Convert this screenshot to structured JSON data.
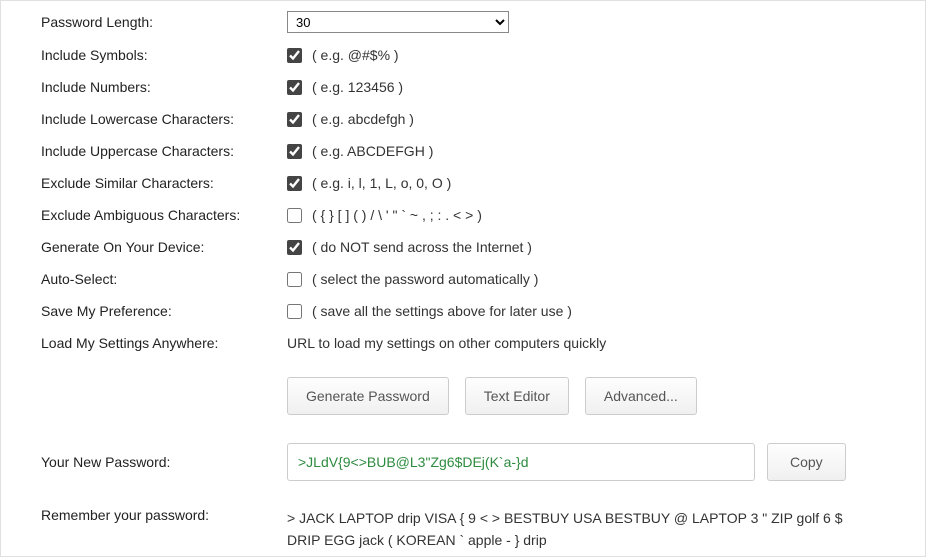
{
  "options": {
    "length": {
      "label": "Password Length:",
      "value": "30"
    },
    "symbols": {
      "label": "Include Symbols:",
      "checked": true,
      "hint": "( e.g. @#$% )"
    },
    "numbers": {
      "label": "Include Numbers:",
      "checked": true,
      "hint": "( e.g. 123456 )"
    },
    "lowercase": {
      "label": "Include Lowercase Characters:",
      "checked": true,
      "hint": "( e.g. abcdefgh )"
    },
    "uppercase": {
      "label": "Include Uppercase Characters:",
      "checked": true,
      "hint": "( e.g. ABCDEFGH )"
    },
    "excludeSimilar": {
      "label": "Exclude Similar Characters:",
      "checked": true,
      "hint": "( e.g. i, l, 1, L, o, 0, O )"
    },
    "excludeAmbiguous": {
      "label": "Exclude Ambiguous Characters:",
      "checked": false,
      "hint": "( { } [ ] ( ) / \\ ' \" ` ~ , ; : . < > )"
    },
    "onDevice": {
      "label": "Generate On Your Device:",
      "checked": true,
      "hint": "( do NOT send across the Internet )"
    },
    "autoSelect": {
      "label": "Auto-Select:",
      "checked": false,
      "hint": "( select the password automatically )"
    },
    "savePref": {
      "label": "Save My Preference:",
      "checked": false,
      "hint": "( save all the settings above for later use )"
    },
    "loadAnywhere": {
      "label": "Load My Settings Anywhere:",
      "hint": "URL to load my settings on other computers quickly"
    }
  },
  "buttons": {
    "generate": "Generate Password",
    "textEditor": "Text Editor",
    "advanced": "Advanced...",
    "copy": "Copy"
  },
  "result": {
    "label": "Your New Password:",
    "value": ">JLdV{9<>BUB@L3\"Zg6$DEj(K`a-}d"
  },
  "remember": {
    "label": "Remember your password:",
    "text": "> JACK LAPTOP drip VISA { 9 < > BESTBUY USA BESTBUY @ LAPTOP 3 \" ZIP golf 6 $ DRIP EGG jack ( KOREAN ` apple - } drip"
  }
}
